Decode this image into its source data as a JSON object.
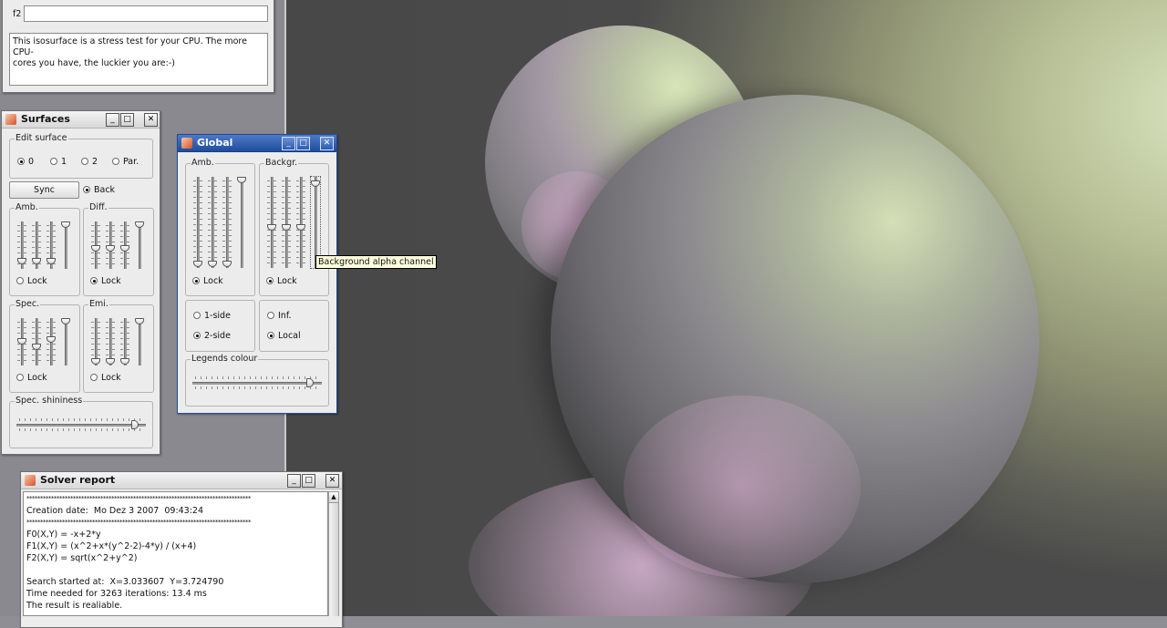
{
  "top_panel": {
    "field_label": "f2",
    "field_value": "",
    "description_lines": [
      "This isosurface is a stress test for your CPU. The more CPU-",
      "cores you have, the luckier you are:-)"
    ]
  },
  "surfaces": {
    "title": "Surfaces",
    "edit_surface": {
      "legend": "Edit surface",
      "options": [
        "0",
        "1",
        "2",
        "Par."
      ],
      "selected": "0"
    },
    "sync_label": "Sync",
    "back_label": "Back",
    "amb": {
      "legend": "Amb.",
      "lock": "Lock",
      "locked": false
    },
    "diff": {
      "legend": "Diff.",
      "lock": "Lock",
      "locked": true
    },
    "spec": {
      "legend": "Spec.",
      "lock": "Lock",
      "locked": false
    },
    "emi": {
      "legend": "Emi.",
      "lock": "Lock",
      "locked": false
    },
    "shininess": {
      "legend": "Spec. shininess",
      "value": 0.94
    }
  },
  "global": {
    "title": "Global",
    "amb": {
      "legend": "Amb.",
      "lock": "Lock",
      "locked": true
    },
    "backgr": {
      "legend": "Backgr.",
      "lock": "Lock",
      "locked": true
    },
    "sides": {
      "one": "1-side",
      "two": "2-side",
      "selected": "2-side"
    },
    "light": {
      "inf": "Inf.",
      "local": "Local",
      "selected": "Local"
    },
    "legends_colour": {
      "legend": "Legends colour",
      "value": 0.93
    },
    "tooltip": "Background alpha channel"
  },
  "solver": {
    "title": "Solver report",
    "lines": [
      "**********************************************************************************",
      "Creation date:  Mo Dez 3 2007  09:43:24",
      "**********************************************************************************",
      "F0(X,Y) = -x+2*y",
      "F1(X,Y) = (x^2+x*(y^2-2)-4*y) / (x+4)",
      "F2(X,Y) = sqrt(x^2+y^2)",
      "",
      "Search started at:  X=3.033607  Y=3.724790",
      "Time needed for 3263 iterations: 13.4 ms",
      "The result is realiable."
    ]
  },
  "window_buttons": {
    "minimize": "_",
    "maximize": "□",
    "close": "✕"
  },
  "colors": {
    "active_titlebar": "#2a5bb0",
    "panel_bg": "#ececec"
  }
}
